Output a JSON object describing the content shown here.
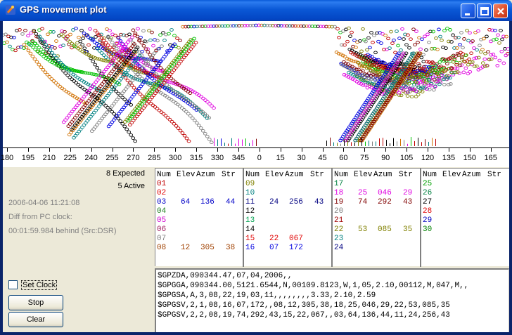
{
  "window": {
    "title": "GPS movement plot"
  },
  "axis": {
    "ticks": [
      "180",
      "195",
      "210",
      "225",
      "240",
      "255",
      "270",
      "285",
      "300",
      "315",
      "330",
      "345",
      "0",
      "15",
      "30",
      "45",
      "60",
      "75",
      "90",
      "105",
      "120",
      "135",
      "150",
      "165"
    ]
  },
  "summary": {
    "expected": "8 Expected",
    "active": "5 Active"
  },
  "status": {
    "timestamp": "2006-04-06 11:21:08",
    "diff_label": "Diff from PC clock:",
    "diff_value": "00:01:59.984 behind  (Src:DSR)"
  },
  "controls": {
    "set_clock": "Set Clock",
    "stop": "Stop",
    "clear": "Clear"
  },
  "table": {
    "headers": [
      "Num",
      "Elev",
      "Azum",
      "Str"
    ],
    "columns": [
      [
        {
          "num": "01",
          "elev": "",
          "azum": "",
          "str": "",
          "color": "#c00000"
        },
        {
          "num": "02",
          "elev": "",
          "azum": "",
          "str": "",
          "color": "#e00000"
        },
        {
          "num": "03",
          "elev": "64",
          "azum": "136",
          "str": "44",
          "color": "#0000c8"
        },
        {
          "num": "04",
          "elev": "",
          "azum": "",
          "str": "",
          "color": "#208020"
        },
        {
          "num": "05",
          "elev": "",
          "azum": "",
          "str": "",
          "color": "#d000d0"
        },
        {
          "num": "06",
          "elev": "",
          "azum": "",
          "str": "",
          "color": "#a02060"
        },
        {
          "num": "07",
          "elev": "",
          "azum": "",
          "str": "",
          "color": "#808080"
        },
        {
          "num": "08",
          "elev": "12",
          "azum": "305",
          "str": "38",
          "color": "#a04000"
        }
      ],
      [
        {
          "num": "09",
          "elev": "",
          "azum": "",
          "str": "",
          "color": "#808000"
        },
        {
          "num": "10",
          "elev": "",
          "azum": "",
          "str": "",
          "color": "#008080"
        },
        {
          "num": "11",
          "elev": "24",
          "azum": "256",
          "str": "43",
          "color": "#000080"
        },
        {
          "num": "12",
          "elev": "",
          "azum": "",
          "str": "",
          "color": "#ffffff"
        },
        {
          "num": "13",
          "elev": "",
          "azum": "",
          "str": "",
          "color": "#00a050"
        },
        {
          "num": "14",
          "elev": "",
          "azum": "",
          "str": "",
          "color": "#000000"
        },
        {
          "num": "15",
          "elev": "22",
          "azum": "067",
          "str": "",
          "color": "#e00000"
        },
        {
          "num": "16",
          "elev": "07",
          "azum": "172",
          "str": "",
          "color": "#0000e0"
        }
      ],
      [
        {
          "num": "17",
          "elev": "",
          "azum": "",
          "str": "",
          "color": "#008040"
        },
        {
          "num": "18",
          "elev": "25",
          "azum": "046",
          "str": "29",
          "color": "#e000e0"
        },
        {
          "num": "19",
          "elev": "74",
          "azum": "292",
          "str": "43",
          "color": "#800000"
        },
        {
          "num": "20",
          "elev": "",
          "azum": "",
          "str": "",
          "color": "#808080"
        },
        {
          "num": "21",
          "elev": "",
          "azum": "",
          "str": "",
          "color": "#a00000"
        },
        {
          "num": "22",
          "elev": "53",
          "azum": "085",
          "str": "35",
          "color": "#808000"
        },
        {
          "num": "23",
          "elev": "",
          "azum": "",
          "str": "",
          "color": "#008080"
        },
        {
          "num": "24",
          "elev": "",
          "azum": "",
          "str": "",
          "color": "#000080"
        }
      ],
      [
        {
          "num": "25",
          "elev": "",
          "azum": "",
          "str": "",
          "color": "#00a000"
        },
        {
          "num": "26",
          "elev": "",
          "azum": "",
          "str": "",
          "color": "#008040"
        },
        {
          "num": "27",
          "elev": "",
          "azum": "",
          "str": "",
          "color": "#000000"
        },
        {
          "num": "28",
          "elev": "",
          "azum": "",
          "str": "",
          "color": "#e00000"
        },
        {
          "num": "29",
          "elev": "",
          "azum": "",
          "str": "",
          "color": "#0000c0"
        },
        {
          "num": "30",
          "elev": "",
          "azum": "",
          "str": "",
          "color": "#008000"
        }
      ]
    ]
  },
  "nmea": [
    "$GPZDA,090344.47,07,04,2006,,",
    "$GPGGA,090344.00,5121.6544,N,00109.8123,W,1,05,2.10,00112,M,047,M,,",
    "$GPGSA,A,3,08,22,19,03,11,,,,,,,,3.33,2.10,2.59",
    "$GPGSV,2,1,08,16,07,172,,08,12,305,38,18,25,046,29,22,53,085,35",
    "$GPGSV,2,2,08,19,74,292,43,15,22,067,,03,64,136,44,11,24,256,43"
  ],
  "plot_colors": [
    "#000000",
    "#0000e0",
    "#00c000",
    "#e000e0",
    "#c00000",
    "#808080",
    "#808000",
    "#008080",
    "#d07000",
    "#800000"
  ]
}
